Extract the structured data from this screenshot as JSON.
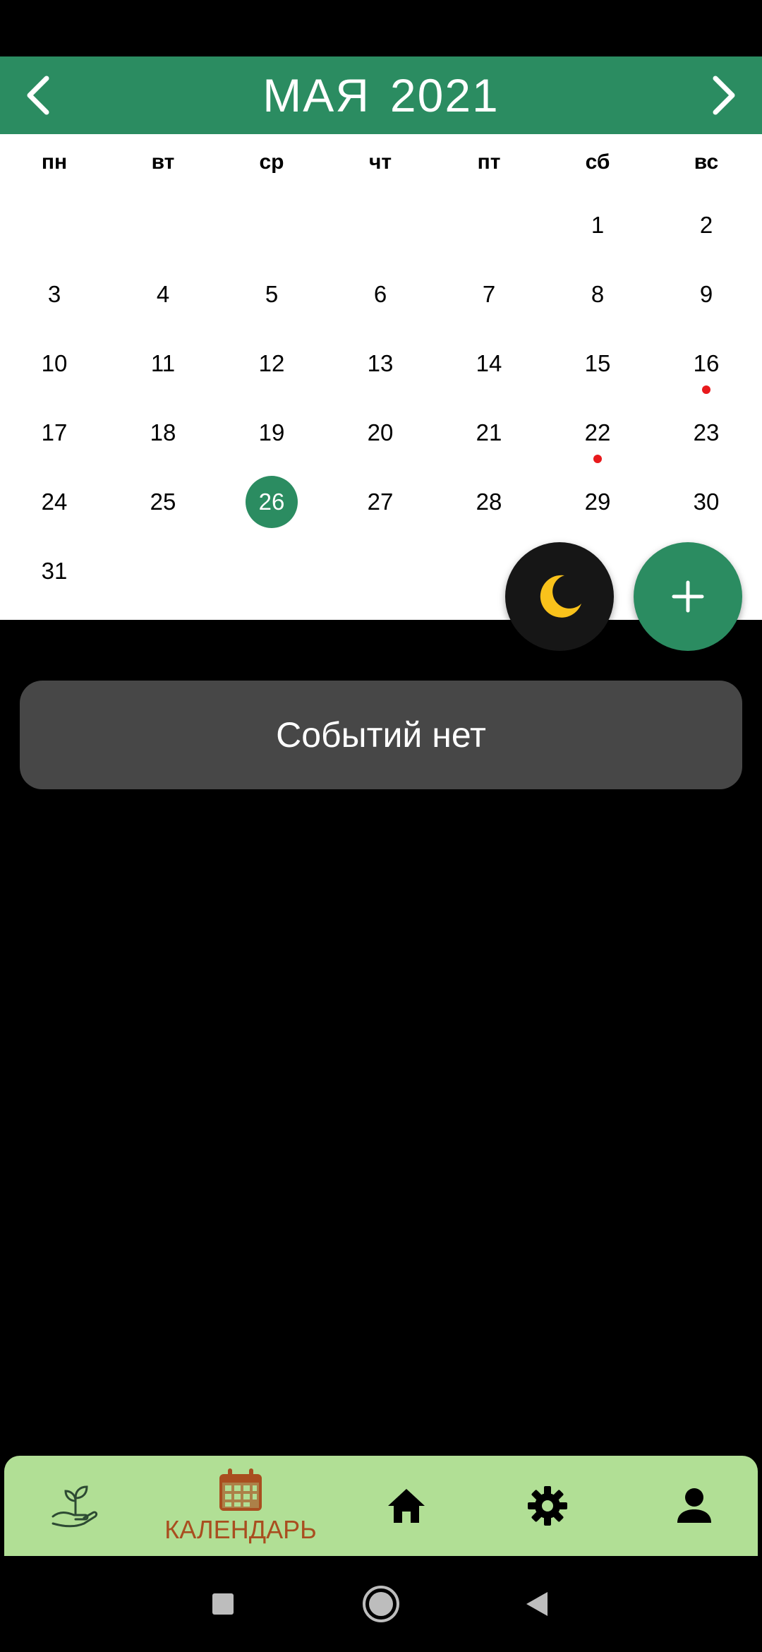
{
  "header": {
    "month": "МАЯ",
    "year": "2021",
    "prev_icon": "chevron-left-icon",
    "next_icon": "chevron-right-icon"
  },
  "weekdays": [
    "пн",
    "вт",
    "ср",
    "чт",
    "пт",
    "сб",
    "вс"
  ],
  "days": [
    {
      "label": "1",
      "row": 0,
      "col": 5
    },
    {
      "label": "2",
      "row": 0,
      "col": 6
    },
    {
      "label": "3",
      "row": 1,
      "col": 0
    },
    {
      "label": "4",
      "row": 1,
      "col": 1
    },
    {
      "label": "5",
      "row": 1,
      "col": 2
    },
    {
      "label": "6",
      "row": 1,
      "col": 3
    },
    {
      "label": "7",
      "row": 1,
      "col": 4
    },
    {
      "label": "8",
      "row": 1,
      "col": 5
    },
    {
      "label": "9",
      "row": 1,
      "col": 6
    },
    {
      "label": "10",
      "row": 2,
      "col": 0
    },
    {
      "label": "11",
      "row": 2,
      "col": 1
    },
    {
      "label": "12",
      "row": 2,
      "col": 2
    },
    {
      "label": "13",
      "row": 2,
      "col": 3
    },
    {
      "label": "14",
      "row": 2,
      "col": 4
    },
    {
      "label": "15",
      "row": 2,
      "col": 5
    },
    {
      "label": "16",
      "row": 2,
      "col": 6,
      "event": true
    },
    {
      "label": "17",
      "row": 3,
      "col": 0
    },
    {
      "label": "18",
      "row": 3,
      "col": 1
    },
    {
      "label": "19",
      "row": 3,
      "col": 2
    },
    {
      "label": "20",
      "row": 3,
      "col": 3
    },
    {
      "label": "21",
      "row": 3,
      "col": 4
    },
    {
      "label": "22",
      "row": 3,
      "col": 5,
      "event": true
    },
    {
      "label": "23",
      "row": 3,
      "col": 6
    },
    {
      "label": "24",
      "row": 4,
      "col": 0
    },
    {
      "label": "25",
      "row": 4,
      "col": 1
    },
    {
      "label": "26",
      "row": 4,
      "col": 2,
      "selected": true
    },
    {
      "label": "27",
      "row": 4,
      "col": 3
    },
    {
      "label": "28",
      "row": 4,
      "col": 4
    },
    {
      "label": "29",
      "row": 4,
      "col": 5
    },
    {
      "label": "30",
      "row": 4,
      "col": 6
    },
    {
      "label": "31",
      "row": 5,
      "col": 0
    }
  ],
  "fabs": {
    "night_icon": "moon-icon",
    "add_icon": "plus-icon"
  },
  "events": {
    "empty_text": "Событий нет"
  },
  "bottom_nav": {
    "items": [
      {
        "icon": "plant-hand-icon",
        "label": ""
      },
      {
        "icon": "calendar-icon",
        "label": "КАЛЕНДАРЬ",
        "active": true
      },
      {
        "icon": "home-icon",
        "label": ""
      },
      {
        "icon": "gear-icon",
        "label": ""
      },
      {
        "icon": "person-icon",
        "label": ""
      }
    ]
  },
  "system_nav": {
    "icons": [
      "recents-square-icon",
      "home-circle-icon",
      "back-triangle-icon"
    ]
  },
  "colors": {
    "accent": "#2b8c61",
    "event_dot": "#e8191c",
    "nav_bg": "#b1df95",
    "nav_active": "#a94e1f",
    "card_bg": "#474747",
    "moon": "#f9c21b"
  }
}
